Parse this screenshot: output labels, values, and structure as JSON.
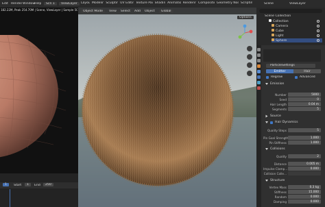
{
  "top_header": {
    "left_menu": [
      "Edit",
      "Render",
      "Window",
      "Help"
    ],
    "scene_label": "Scn 1",
    "view_layer": "ViewLayer",
    "workspace_tabs": [
      "Layout",
      "Modeling",
      "Sculpting",
      "UV Editing",
      "Texture Paint",
      "Shading",
      "Animation",
      "Rendering",
      "Compositing",
      "Geometry Nodes",
      "Scripting"
    ],
    "right_scene": "Scene",
    "right_view_layer": "ViewLayer"
  },
  "left_view": {
    "stats": "182.22M, Peak 254.70M | Scene, ViewLayer | Sample 507/1024"
  },
  "viewport_header": {
    "mode": "Object Mode",
    "menus": [
      "View",
      "Select",
      "Add",
      "Object"
    ],
    "global": "Global",
    "options": "Options"
  },
  "timeline": {
    "frame": "1",
    "start_label": "Start",
    "start": "1",
    "end_label": "End",
    "end": "250"
  },
  "outliner": {
    "title": "Scene Collection",
    "items": [
      {
        "label": "Collection",
        "color": "#c9c9c9"
      },
      {
        "label": "Camera",
        "color": "#d6a55a"
      },
      {
        "label": "Cube",
        "color": "#d6a55a"
      },
      {
        "label": "Light",
        "color": "#d6a55a"
      },
      {
        "label": "Sphere",
        "color": "#d6a55a"
      }
    ]
  },
  "properties": {
    "system_name": "ParticleSettings",
    "tabs": [
      "Emitter",
      "Hair"
    ],
    "active_tab": "Hair",
    "regrow_label": "Regrow",
    "advanced_label": "Advanced",
    "emission": {
      "title": "Emission",
      "rows": [
        {
          "label": "Number",
          "value": "5000"
        },
        {
          "label": "Seed",
          "value": "0"
        },
        {
          "label": "Hair Length",
          "value": "0.04 m"
        },
        {
          "label": "Segments",
          "value": "5"
        }
      ]
    },
    "source_title": "Source",
    "hair_dynamics": {
      "title": "Hair Dynamics",
      "rows": [
        {
          "label": "Quality Steps",
          "value": "5"
        },
        {
          "label": "Pin Goal Strength",
          "value": "1.000"
        },
        {
          "label": "Pin Stiffness",
          "value": "1.000"
        }
      ]
    },
    "collisions": {
      "title": "Collisions",
      "rows": [
        {
          "label": "Quality",
          "value": "2"
        },
        {
          "label": "Distance",
          "value": "0.005 m"
        },
        {
          "label": "Impulse Clamp...",
          "value": "0.000"
        },
        {
          "label": "Collision Colle...",
          "value": ""
        }
      ]
    },
    "structure": {
      "title": "Structure",
      "rows": [
        {
          "label": "Vertex Mass",
          "value": "0.3 kg"
        },
        {
          "label": "Stiffness",
          "value": "15.000"
        },
        {
          "label": "Random",
          "value": "0.000"
        },
        {
          "label": "Damping",
          "value": "0.000"
        }
      ]
    }
  },
  "colors": {
    "accent": "#4772b3",
    "panel_bg": "#303030",
    "field_bg": "#545454",
    "viewport_bg": "#3d3d3d"
  }
}
